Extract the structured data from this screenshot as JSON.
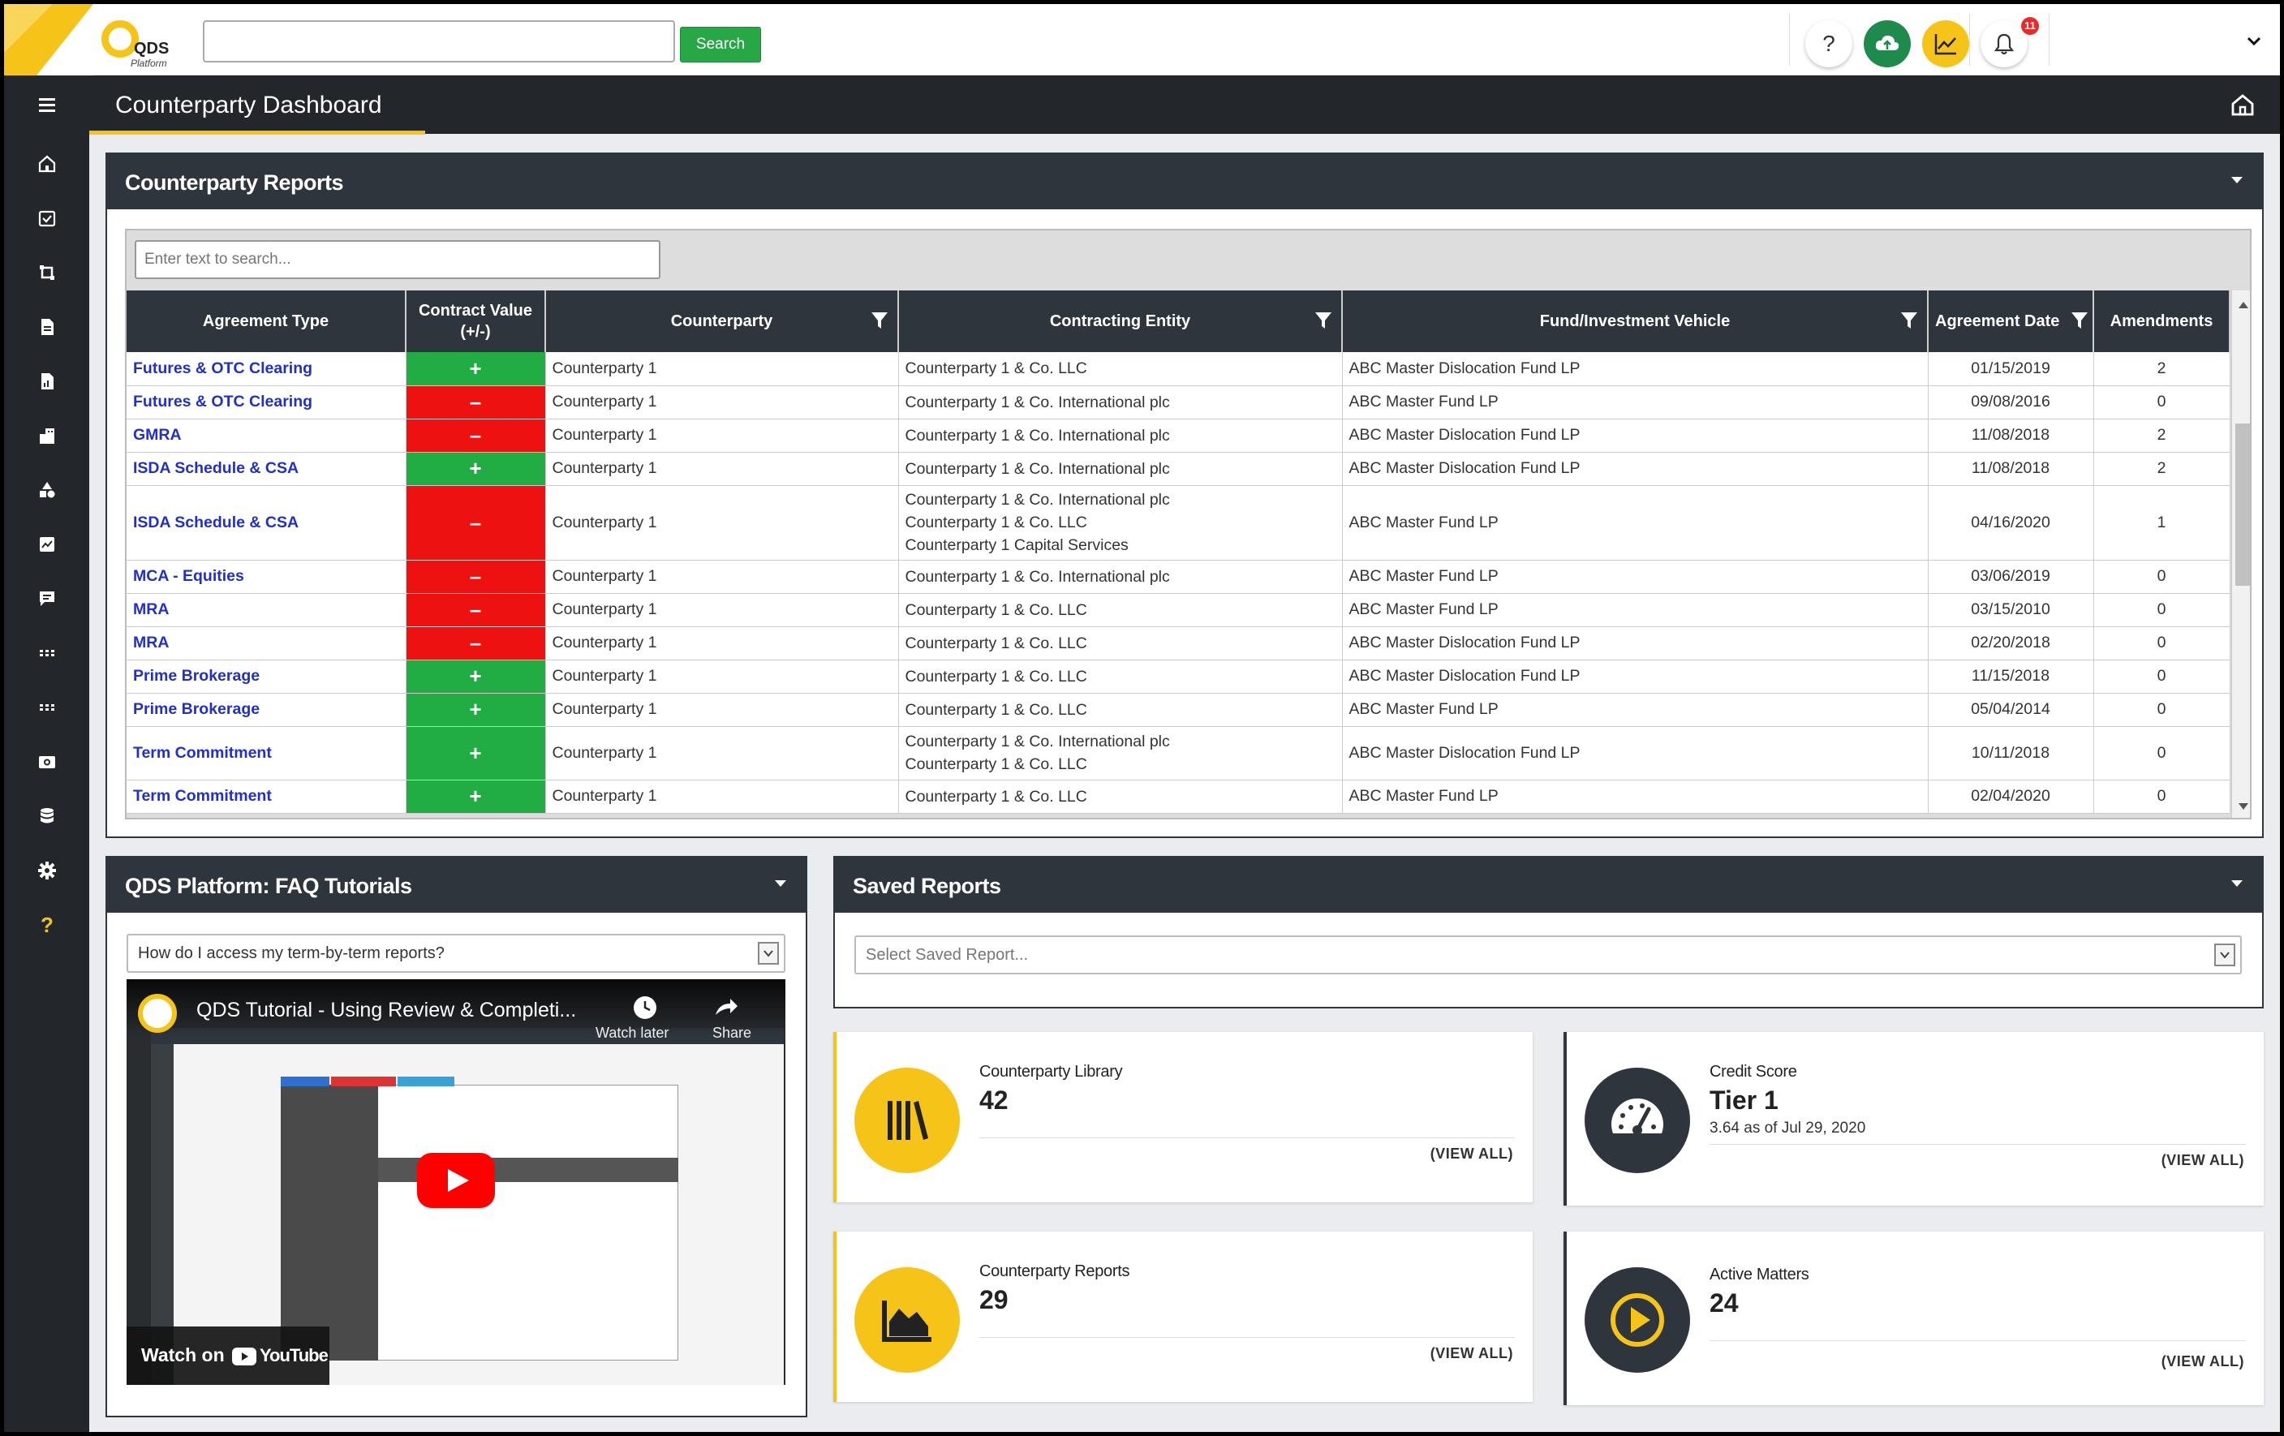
{
  "app": {
    "logo_text": "QDS",
    "logo_sub": "Platform",
    "search_placeholder": "",
    "search_button": "Search",
    "notification_count": "11",
    "help_label": "?"
  },
  "page": {
    "title": "Counterparty Dashboard"
  },
  "sidebar": {
    "icons": [
      "home-icon",
      "tasks-icon",
      "crop-icon",
      "document-icon",
      "file-chart-icon",
      "building-icon",
      "shapes-icon",
      "analytics-icon",
      "comment-icon",
      "grid-icon",
      "apps-icon",
      "camera-icon",
      "database-icon",
      "settings-icon",
      "help-icon"
    ],
    "help_glyph": "?"
  },
  "reports": {
    "title": "Counterparty Reports",
    "search_placeholder": "Enter text to search...",
    "columns": [
      "Agreement Type",
      "Contract Value (+/-)",
      "Counterparty",
      "Contracting Entity",
      "Fund/Investment Vehicle",
      "Agreement Date",
      "Amendments"
    ],
    "rows": [
      {
        "type": "Futures & OTC Clearing",
        "sign": "+",
        "counterparty": "Counterparty 1",
        "entity": [
          "Counterparty 1 & Co. LLC"
        ],
        "fund": "ABC Master Dislocation Fund LP",
        "date": "01/15/2019",
        "amendments": "2"
      },
      {
        "type": "Futures & OTC Clearing",
        "sign": "–",
        "counterparty": "Counterparty 1",
        "entity": [
          "Counterparty 1 & Co. International plc"
        ],
        "fund": "ABC Master Fund LP",
        "date": "09/08/2016",
        "amendments": "0"
      },
      {
        "type": "GMRA",
        "sign": "–",
        "counterparty": "Counterparty 1",
        "entity": [
          "Counterparty 1 & Co. International plc"
        ],
        "fund": "ABC Master Dislocation Fund LP",
        "date": "11/08/2018",
        "amendments": "2"
      },
      {
        "type": "ISDA Schedule & CSA",
        "sign": "+",
        "counterparty": "Counterparty 1",
        "entity": [
          "Counterparty 1 & Co. International plc"
        ],
        "fund": "ABC Master Dislocation Fund LP",
        "date": "11/08/2018",
        "amendments": "2"
      },
      {
        "type": "ISDA Schedule & CSA",
        "sign": "–",
        "counterparty": "Counterparty 1",
        "entity": [
          "Counterparty 1 & Co. International plc",
          "Counterparty 1 & Co. LLC",
          "Counterparty 1 Capital Services"
        ],
        "fund": "ABC Master Fund LP",
        "date": "04/16/2020",
        "amendments": "1"
      },
      {
        "type": "MCA - Equities",
        "sign": "–",
        "counterparty": "Counterparty 1",
        "entity": [
          "Counterparty 1 & Co. International plc"
        ],
        "fund": "ABC Master Fund LP",
        "date": "03/06/2019",
        "amendments": "0"
      },
      {
        "type": "MRA",
        "sign": "–",
        "counterparty": "Counterparty 1",
        "entity": [
          "Counterparty 1 & Co. LLC"
        ],
        "fund": "ABC Master Fund LP",
        "date": "03/15/2010",
        "amendments": "0"
      },
      {
        "type": "MRA",
        "sign": "–",
        "counterparty": "Counterparty 1",
        "entity": [
          "Counterparty 1 & Co. LLC"
        ],
        "fund": "ABC Master Dislocation Fund LP",
        "date": "02/20/2018",
        "amendments": "0"
      },
      {
        "type": "Prime Brokerage",
        "sign": "+",
        "counterparty": "Counterparty 1",
        "entity": [
          "Counterparty 1 & Co. LLC"
        ],
        "fund": "ABC Master Dislocation Fund LP",
        "date": "11/15/2018",
        "amendments": "0"
      },
      {
        "type": "Prime Brokerage",
        "sign": "+",
        "counterparty": "Counterparty 1",
        "entity": [
          "Counterparty 1 & Co. LLC"
        ],
        "fund": "ABC Master Fund LP",
        "date": "05/04/2014",
        "amendments": "0"
      },
      {
        "type": "Term Commitment",
        "sign": "+",
        "counterparty": "Counterparty 1",
        "entity": [
          "Counterparty 1 & Co. International plc",
          "Counterparty 1 & Co. LLC"
        ],
        "fund": "ABC Master Dislocation Fund LP",
        "date": "10/11/2018",
        "amendments": "0"
      },
      {
        "type": "Term Commitment",
        "sign": "+",
        "counterparty": "Counterparty 1",
        "entity": [
          "Counterparty 1 & Co. LLC"
        ],
        "fund": "ABC Master Fund LP",
        "date": "02/04/2020",
        "amendments": "0"
      }
    ]
  },
  "faq": {
    "title": "QDS Platform: FAQ Tutorials",
    "selected_question": "How do I access my term-by-term reports?",
    "video_title": "QDS Tutorial - Using Review & Completi...",
    "video_watch_later": "Watch later",
    "video_share": "Share",
    "video_watch_on": "Watch on",
    "video_youtube": "YouTube"
  },
  "saved_reports": {
    "title": "Saved Reports",
    "placeholder": "Select Saved Report..."
  },
  "stats": [
    {
      "label": "Counterparty Library",
      "value": "42",
      "sub": "",
      "link": "(VIEW ALL)",
      "icon": "library-icon"
    },
    {
      "label": "Credit Score",
      "value": "Tier 1",
      "sub": "3.64 as of Jul 29, 2020",
      "link": "(VIEW ALL)",
      "icon": "speedometer-icon"
    },
    {
      "label": "Counterparty Reports",
      "value": "29",
      "sub": "",
      "link": "(VIEW ALL)",
      "icon": "area-chart-icon"
    },
    {
      "label": "Active Matters",
      "value": "24",
      "sub": "",
      "link": "(VIEW ALL)",
      "icon": "play-icon"
    }
  ],
  "colors": {
    "accent": "#f6c319",
    "dark": "#2e353d",
    "positive": "#22ad44",
    "negative": "#ee1111",
    "link": "#2030c8"
  }
}
